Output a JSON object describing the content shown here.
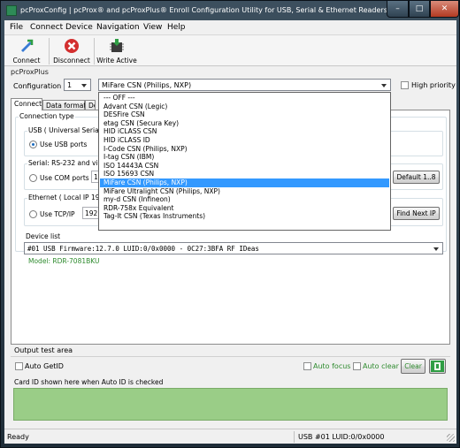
{
  "window": {
    "title": "pcProxConfig | pcProx® and pcProxPlus® Enroll Configuration Utility for USB, Serial & Ethernet Readers",
    "minimize": "–",
    "maximize": "□",
    "close": "✕"
  },
  "menu": [
    "File",
    "Connect",
    "Device",
    "Navigation",
    "View",
    "Help"
  ],
  "toolbar": {
    "connect": "Connect",
    "disconnect": "Disconnect",
    "write_active": "Write Active"
  },
  "product": "pcProxPlus",
  "config": {
    "label": "Configuration #",
    "number": "1",
    "card_type": "MiFare CSN (Philips, NXP)",
    "high_priority": "High priority"
  },
  "tabs": [
    "Connect",
    "Data format",
    "Delay"
  ],
  "connection": {
    "group_title": "Connection type",
    "usb_title": "USB ( Universal Serial B",
    "usb_option": "Use USB ports",
    "serial_title": "Serial: RS-232 and virtu",
    "com_option": "Use COM ports",
    "com_value": "1",
    "default_button": "Default 1..8",
    "ethernet_title": "Ethernet ( Local IP 192.",
    "tcp_option": "Use TCP/IP",
    "ip_value": "192",
    "find_next": "Find Next IP"
  },
  "device_list": {
    "label": "Device list",
    "selected": "#01 USB Firmware:12.7.0 LUID:0/0x0000 - 0C27:3BFA RF IDeas",
    "model": "Model: RDR-7081BKU"
  },
  "dropdown": {
    "items": [
      "--- OFF ---",
      "Advant CSN (Legic)",
      "DESFire CSN",
      "etag CSN (Secura Key)",
      "HID iCLASS CSN",
      "HID iCLASS ID",
      "I-Code CSN (Philips, NXP)",
      "I-tag CSN (IBM)",
      "ISO 14443A CSN",
      "ISO 15693  CSN",
      "MiFare CSN (Philips, NXP)",
      "MiFare Ultralight CSN (Philips, NXP)",
      "my-d CSN (Infineon)",
      "RDR-758x Equivalent",
      "Tag-It CSN (Texas Instruments)"
    ],
    "selected_index": 10
  },
  "output": {
    "label": "Output test area",
    "auto_getid": "Auto GetID",
    "auto_focus": "Auto focus",
    "auto_clear": "Auto clear",
    "clear_button": "Clear",
    "card_hint": "Card ID shown here when Auto ID is checked"
  },
  "status": {
    "left": "Ready",
    "right": "USB #01 LUID:0/0x0000"
  },
  "colors": {
    "output_area": "#9acd87",
    "selection": "#3399ff",
    "accent_green": "#2e8b2e"
  }
}
